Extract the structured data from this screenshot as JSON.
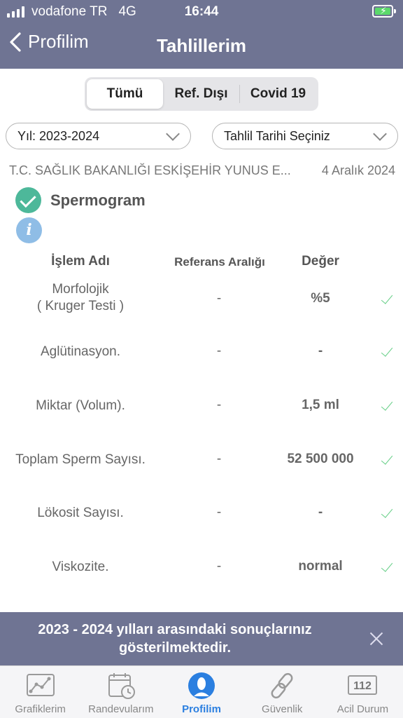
{
  "status_bar": {
    "carrier": "vodafone TR",
    "network": "4G",
    "time": "16:44"
  },
  "nav": {
    "back_label": "Profilim",
    "title": "Tahlillerim"
  },
  "segments": [
    {
      "label": "Tümü",
      "active": true
    },
    {
      "label": "Ref. Dışı",
      "active": false
    },
    {
      "label": "Covid 19",
      "active": false
    }
  ],
  "filters": {
    "year": "Yıl: 2023-2024",
    "date": "Tahlil Tarihi Seçiniz"
  },
  "lab": {
    "institution": "T.C. SAĞLIK BAKANLIĞI ESKİŞEHİR YUNUS E...",
    "date": "4 Aralık 2024"
  },
  "test": {
    "name": "Spermogram",
    "headers": {
      "name": "İşlem Adı",
      "range": "Referans Aralığı",
      "value": "Değer"
    },
    "rows": [
      {
        "name": "Morfolojik\n( Kruger Testi )",
        "range": "-",
        "value": "%5"
      },
      {
        "name": "Aglütinasyon.",
        "range": "-",
        "value": "-"
      },
      {
        "name": "Miktar (Volum).",
        "range": "-",
        "value": "1,5 ml"
      },
      {
        "name": "Toplam Sperm Sayısı.",
        "range": "-",
        "value": "52 500 000"
      },
      {
        "name": "Lökosit Sayısı.",
        "range": "-",
        "value": "-"
      },
      {
        "name": "Viskozite.",
        "range": "-",
        "value": "normal"
      }
    ]
  },
  "banner": {
    "message": "2023 - 2024 yılları arasındaki sonuçlarınız gösterilmektedir."
  },
  "tabbar": [
    {
      "label": "Grafiklerim",
      "icon": "chart-icon"
    },
    {
      "label": "Randevularım",
      "icon": "calendar-icon"
    },
    {
      "label": "Profilim",
      "icon": "profile-icon",
      "active": true
    },
    {
      "label": "Güvenlik",
      "icon": "link-icon"
    },
    {
      "label": "Acil Durum",
      "icon": "emergency-112-icon",
      "badge": "112"
    }
  ],
  "colors": {
    "header": "#6f7493",
    "accent": "#2b7fe0",
    "check": "#4db89a"
  }
}
